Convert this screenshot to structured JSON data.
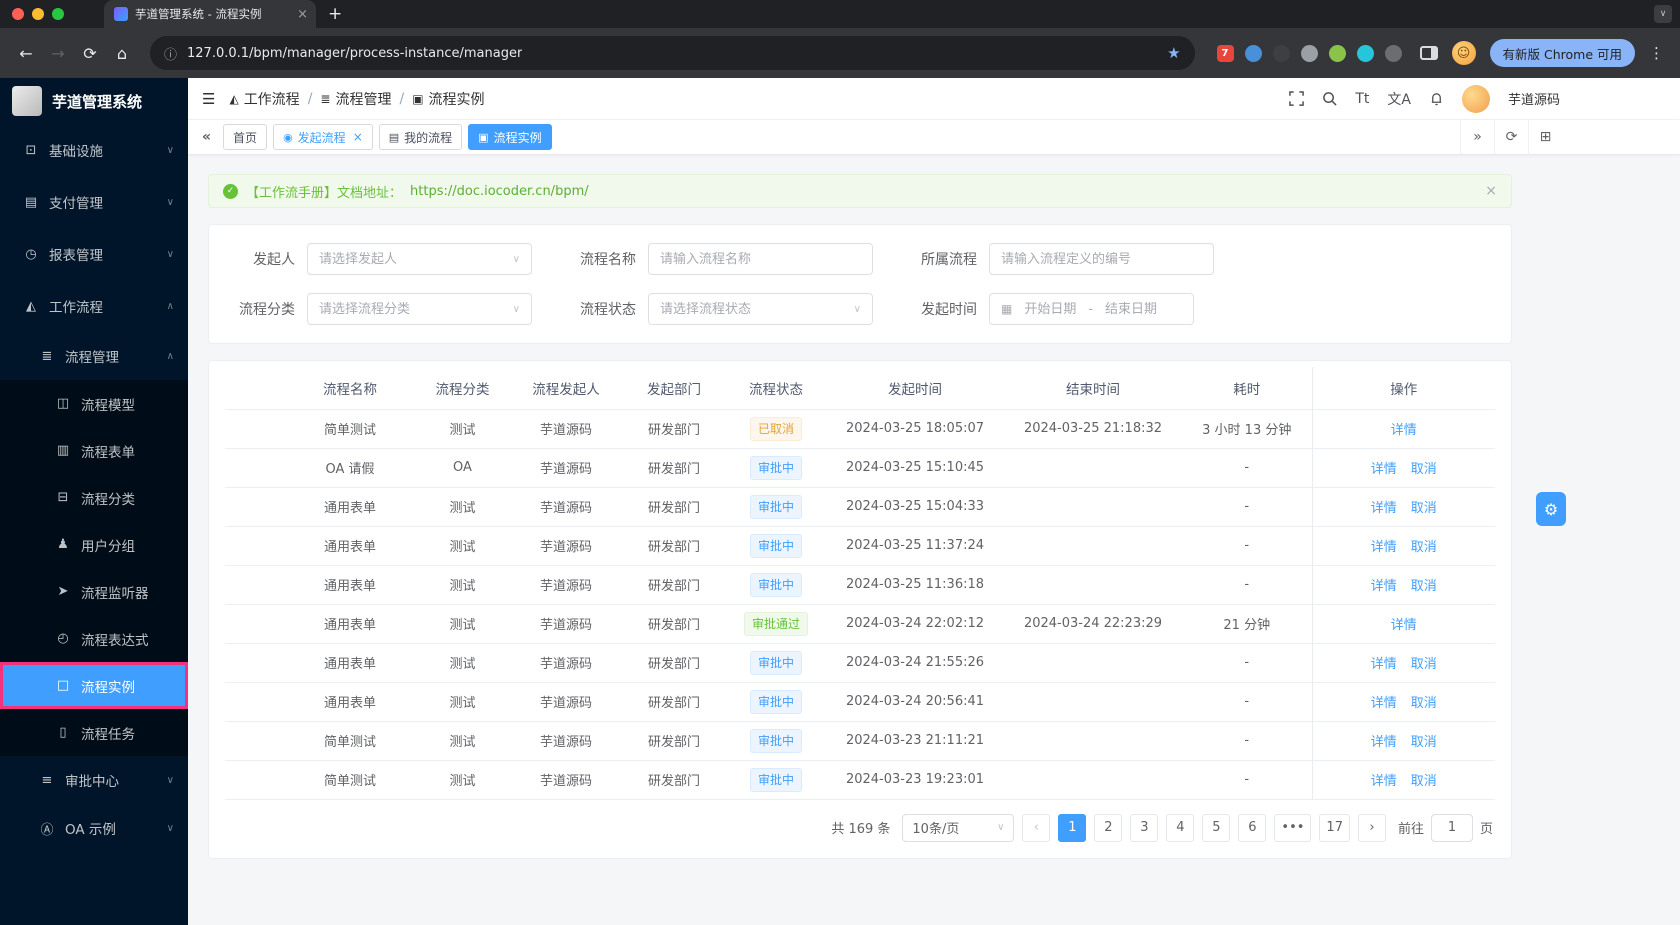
{
  "colors": {
    "primary": "#409eff",
    "success": "#67c23a",
    "warning": "#e6a23c",
    "sidebar": "#001529",
    "highlight": "#f5317f"
  },
  "icons": {
    "back": "←",
    "forward": "→",
    "refresh": "⟳",
    "home": "⌂",
    "info": "ⓘ",
    "star": "★",
    "dots": "⋮",
    "plus": "+",
    "tab_search": "∨",
    "close": "×",
    "smiley": "☺",
    "hamburger": "☰",
    "collapse_left": "«",
    "collapse_right": "»",
    "tag_refresh": "⟳",
    "grid": "⊞",
    "check": "✓",
    "gear": "⚙",
    "calendar": "▦",
    "chevron_down": "∨",
    "chevron_up": "∧"
  },
  "browser": {
    "tab_title": "芋道管理系统 - 流程实例",
    "url": "127.0.0.1/bpm/manager/process-instance/manager",
    "update_button": "有新版 Chrome 可用",
    "extensions": [
      {
        "name": "ext-red-badge-icon",
        "color": "#e8453c",
        "badge": "7"
      },
      {
        "name": "ext-pin-icon",
        "color": "#4a90d9"
      },
      {
        "name": "ext-globe-icon",
        "color": "#3c4043"
      },
      {
        "name": "ext-gray-circle-icon",
        "color": "#9aa0a6"
      },
      {
        "name": "ext-green-icon",
        "color": "#8bc34a"
      },
      {
        "name": "ext-teal-icon",
        "color": "#26c6da"
      },
      {
        "name": "extensions-puzzle-icon",
        "color": "#6b6e71"
      }
    ]
  },
  "sidebar": {
    "logo_title": "芋道管理系统",
    "menu": [
      {
        "name": "infrastructure",
        "label": "基础设施",
        "glyph": "⊡",
        "icon": "monitor-icon",
        "level": 0,
        "chevron": "down"
      },
      {
        "name": "payment",
        "label": "支付管理",
        "glyph": "▤",
        "icon": "payment-icon",
        "level": 0,
        "chevron": "down"
      },
      {
        "name": "report",
        "label": "报表管理",
        "glyph": "◷",
        "icon": "report-icon",
        "level": 0,
        "chevron": "down"
      },
      {
        "name": "workflow",
        "label": "工作流程",
        "glyph": "◭",
        "icon": "workflow-icon",
        "level": 0,
        "chevron": "up"
      },
      {
        "name": "process-management",
        "label": "流程管理",
        "glyph": "≣",
        "icon": "process-management-icon",
        "level": 1,
        "chevron": "up"
      },
      {
        "name": "process-model",
        "label": "流程模型",
        "glyph": "◫",
        "icon": "process-model-icon",
        "level": 2
      },
      {
        "name": "process-form",
        "label": "流程表单",
        "glyph": "▥",
        "icon": "process-form-icon",
        "level": 2
      },
      {
        "name": "process-category",
        "label": "流程分类",
        "glyph": "⊟",
        "icon": "process-category-icon",
        "level": 2
      },
      {
        "name": "user-group",
        "label": "用户分组",
        "glyph": "♟",
        "icon": "user-group-icon",
        "level": 2
      },
      {
        "name": "process-listener",
        "label": "流程监听器",
        "glyph": "➤",
        "icon": "process-listener-icon",
        "level": 2
      },
      {
        "name": "process-expression",
        "label": "流程表达式",
        "glyph": "◴",
        "icon": "process-expression-icon",
        "level": 2
      },
      {
        "name": "process-instance",
        "label": "流程实例",
        "glyph": "□",
        "icon": "process-instance-icon",
        "level": 2,
        "active": true,
        "highlighted": true
      },
      {
        "name": "process-task",
        "label": "流程任务",
        "glyph": "▯",
        "icon": "process-task-icon",
        "level": 2
      },
      {
        "name": "approval-center",
        "label": "审批中心",
        "glyph": "≡",
        "icon": "approval-center-icon",
        "level": 1,
        "chevron": "down"
      },
      {
        "name": "oa-example",
        "label": "OA 示例",
        "glyph": "Ⓐ",
        "icon": "oa-example-icon",
        "level": 1,
        "chevron": "down"
      }
    ]
  },
  "header": {
    "breadcrumb": [
      {
        "label": "工作流程",
        "glyph": "◭",
        "icon": "workflow-icon"
      },
      {
        "label": "流程管理",
        "glyph": "≣",
        "icon": "process-management-icon"
      },
      {
        "label": "流程实例",
        "glyph": "▣",
        "icon": "process-instance-icon"
      }
    ],
    "font_icon": "Tt",
    "translate_icon": "文A",
    "username": "芋道源码"
  },
  "tagbar": {
    "tabs": [
      {
        "name": "home",
        "label": "首页",
        "active": false,
        "closable": false
      },
      {
        "name": "start-process",
        "label": "发起流程",
        "glyph": "◉",
        "icon": "start-process-icon",
        "active": false,
        "closable": true,
        "accent": true
      },
      {
        "name": "my-process",
        "label": "我的流程",
        "glyph": "▤",
        "icon": "my-process-icon",
        "active": false,
        "closable": false
      },
      {
        "name": "process-instance",
        "label": "流程实例",
        "glyph": "▣",
        "icon": "process-instance-icon",
        "active": true,
        "closable": false
      }
    ]
  },
  "banner": {
    "text": "【工作流手册】文档地址：",
    "link": "https://doc.iocoder.cn/bpm/"
  },
  "filters": {
    "fields": [
      {
        "name": "initiator-select",
        "label": "发起人",
        "placeholder": "请选择发起人",
        "type": "select"
      },
      {
        "name": "process-name-input",
        "label": "流程名称",
        "placeholder": "请输入流程名称",
        "type": "input"
      },
      {
        "name": "process-definition-input",
        "label": "所属流程",
        "placeholder": "请输入流程定义的编号",
        "type": "input"
      },
      {
        "name": "category-select",
        "label": "流程分类",
        "placeholder": "请选择流程分类",
        "type": "select"
      },
      {
        "name": "status-select",
        "label": "流程状态",
        "placeholder": "请选择流程状态",
        "type": "select"
      },
      {
        "name": "date-range-picker",
        "label": "发起时间",
        "placeholder_start": "开始日期",
        "placeholder_end": "结束日期",
        "separator": "-",
        "type": "daterange"
      }
    ]
  },
  "table": {
    "columns": [
      "流程名称",
      "流程分类",
      "流程发起人",
      "发起部门",
      "流程状态",
      "发起时间",
      "结束时间",
      "耗时",
      "操作"
    ],
    "rows": [
      {
        "name": "简单测试",
        "category": "测试",
        "initiator": "芋道源码",
        "dept": "研发部门",
        "status": "已取消",
        "status_type": "warning",
        "start": "2024-03-25 18:05:07",
        "end": "2024-03-25 21:18:32",
        "duration": "3 小时 13 分钟",
        "actions": [
          "详情"
        ]
      },
      {
        "name": "OA 请假",
        "category": "OA",
        "initiator": "芋道源码",
        "dept": "研发部门",
        "status": "审批中",
        "status_type": "primary",
        "start": "2024-03-25 15:10:45",
        "end": "",
        "duration": "-",
        "actions": [
          "详情",
          "取消"
        ]
      },
      {
        "name": "通用表单",
        "category": "测试",
        "initiator": "芋道源码",
        "dept": "研发部门",
        "status": "审批中",
        "status_type": "primary",
        "start": "2024-03-25 15:04:33",
        "end": "",
        "duration": "-",
        "actions": [
          "详情",
          "取消"
        ]
      },
      {
        "name": "通用表单",
        "category": "测试",
        "initiator": "芋道源码",
        "dept": "研发部门",
        "status": "审批中",
        "status_type": "primary",
        "start": "2024-03-25 11:37:24",
        "end": "",
        "duration": "-",
        "actions": [
          "详情",
          "取消"
        ]
      },
      {
        "name": "通用表单",
        "category": "测试",
        "initiator": "芋道源码",
        "dept": "研发部门",
        "status": "审批中",
        "status_type": "primary",
        "start": "2024-03-25 11:36:18",
        "end": "",
        "duration": "-",
        "actions": [
          "详情",
          "取消"
        ]
      },
      {
        "name": "通用表单",
        "category": "测试",
        "initiator": "芋道源码",
        "dept": "研发部门",
        "status": "审批通过",
        "status_type": "success",
        "start": "2024-03-24 22:02:12",
        "end": "2024-03-24 22:23:29",
        "duration": "21 分钟",
        "actions": [
          "详情"
        ]
      },
      {
        "name": "通用表单",
        "category": "测试",
        "initiator": "芋道源码",
        "dept": "研发部门",
        "status": "审批中",
        "status_type": "primary",
        "start": "2024-03-24 21:55:26",
        "end": "",
        "duration": "-",
        "actions": [
          "详情",
          "取消"
        ]
      },
      {
        "name": "通用表单",
        "category": "测试",
        "initiator": "芋道源码",
        "dept": "研发部门",
        "status": "审批中",
        "status_type": "primary",
        "start": "2024-03-24 20:56:41",
        "end": "",
        "duration": "-",
        "actions": [
          "详情",
          "取消"
        ]
      },
      {
        "name": "简单测试",
        "category": "测试",
        "initiator": "芋道源码",
        "dept": "研发部门",
        "status": "审批中",
        "status_type": "primary",
        "start": "2024-03-23 21:11:21",
        "end": "",
        "duration": "-",
        "actions": [
          "详情",
          "取消"
        ]
      },
      {
        "name": "简单测试",
        "category": "测试",
        "initiator": "芋道源码",
        "dept": "研发部门",
        "status": "审批中",
        "status_type": "primary",
        "start": "2024-03-23 19:23:01",
        "end": "",
        "duration": "-",
        "actions": [
          "详情",
          "取消"
        ]
      }
    ]
  },
  "pagination": {
    "total": "共 169 条",
    "page_size": "10条/页",
    "pages": [
      "1",
      "2",
      "3",
      "4",
      "5",
      "6",
      "•••",
      "17"
    ],
    "active_page": "1",
    "goto_label": "前往",
    "goto_value": "1",
    "goto_suffix": "页"
  }
}
